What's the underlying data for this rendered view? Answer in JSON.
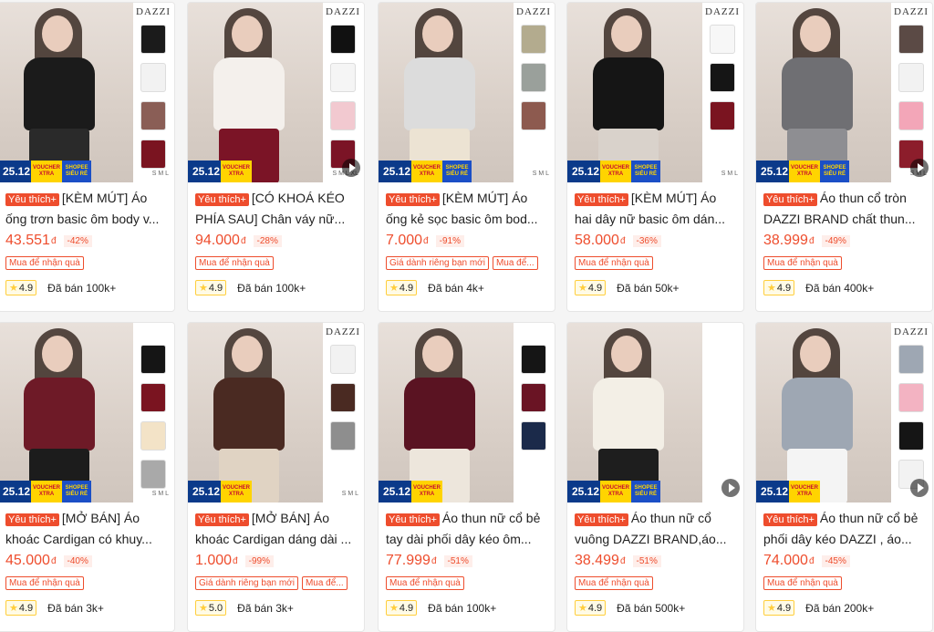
{
  "products": [
    {
      "promo_date": "25.12",
      "promo_v1": "VOUCHER XTRA",
      "promo_v2": "SHOPEE SIÊU RẺ",
      "badge": "Yêu thích+",
      "title": "[KÈM MÚT] Áo ống trơn basic ôm body v...",
      "price": "43.551",
      "currency": "đ",
      "discount": "-42%",
      "tags": [
        "Mua để nhận quà"
      ],
      "rating": "4.9",
      "sold": "Đã bán 100k+",
      "brand": "DAZZI",
      "sizes": "S M L",
      "top_color": "#1b1b1b",
      "bottom_color": "#2a2a2a",
      "swatches": [
        "#1b1b1b",
        "#f2f2f2",
        "#8a5e56",
        "#7a1420"
      ],
      "video": false
    },
    {
      "promo_date": "25.12",
      "promo_v1": "VOUCHER XTRA",
      "promo_v2": "",
      "badge": "Yêu thích+",
      "title": "[CÓ KHOÁ KÉO PHÍA SAU] Chân váy nữ...",
      "price": "94.000",
      "currency": "đ",
      "discount": "-28%",
      "tags": [
        "Mua để nhận quà"
      ],
      "rating": "4.9",
      "sold": "Đã bán 100k+",
      "brand": "DAZZI",
      "sizes": "S M L XL",
      "top_color": "#f4f0ec",
      "bottom_color": "#7b1426",
      "swatches": [
        "#111111",
        "#f5f5f5",
        "#f2c9d0",
        "#7b1426"
      ],
      "video": true
    },
    {
      "promo_date": "25.12",
      "promo_v1": "VOUCHER XTRA",
      "promo_v2": "SHOPEE SIÊU RẺ",
      "badge": "Yêu thích+",
      "title": "[KÈM MÚT] Áo ống kẻ sọc basic ôm bod...",
      "price": "7.000",
      "currency": "đ",
      "discount": "-91%",
      "tags": [
        "Giá dành riêng bạn mới",
        "Mua để..."
      ],
      "rating": "4.9",
      "sold": "Đã bán 4k+",
      "brand": "DAZZI",
      "sizes": "S M L",
      "top_color": "#dcdcdc",
      "bottom_color": "#ece3d3",
      "swatches": [
        "#b3ab8e",
        "#9aa09b",
        "#8d5a4f"
      ],
      "video": false
    },
    {
      "promo_date": "25.12",
      "promo_v1": "VOUCHER XTRA",
      "promo_v2": "SHOPEE SIÊU RẺ",
      "badge": "Yêu thích+",
      "title": "[KÈM MÚT] Áo hai dây nữ basic ôm dán...",
      "price": "58.000",
      "currency": "đ",
      "discount": "-36%",
      "tags": [
        "Mua để nhận quà"
      ],
      "rating": "4.9",
      "sold": "Đã bán 50k+",
      "brand": "DAZZI",
      "sizes": "S M L",
      "top_color": "#151515",
      "bottom_color": "#d9d2cb",
      "swatches": [
        "#f7f7f7",
        "#151515",
        "#7a1420"
      ],
      "video": false
    },
    {
      "promo_date": "25.12",
      "promo_v1": "VOUCHER XTRA",
      "promo_v2": "SHOPEE SIÊU RẺ",
      "badge": "Yêu thích+",
      "title": "Áo thun cổ tròn DAZZI BRAND chất thun...",
      "price": "38.999",
      "currency": "đ",
      "discount": "-49%",
      "tags": [
        "Mua để nhận quà"
      ],
      "rating": "4.9",
      "sold": "Đã bán 400k+",
      "brand": "DAZZI",
      "sizes": "S M L",
      "top_color": "#6f6f73",
      "bottom_color": "#8e8e92",
      "swatches": [
        "#5b4a45",
        "#f2f2f2",
        "#f3a6b8",
        "#8c1d2b"
      ],
      "video": true
    },
    {
      "promo_date": "25.12",
      "promo_v1": "VOUCHER XTRA",
      "promo_v2": "SHOPEE SIÊU RẺ",
      "badge": "Yêu thích+",
      "title": "[MỞ BÁN] Áo khoác Cardigan có khuy...",
      "price": "45.000",
      "currency": "đ",
      "discount": "-40%",
      "tags": [
        "Mua để nhận quà"
      ],
      "rating": "4.9",
      "sold": "Đã bán 3k+",
      "brand": "",
      "sizes": "S M L",
      "top_color": "#6e1a27",
      "bottom_color": "#1c1c1c",
      "swatches": [
        "#151515",
        "#7a1420",
        "#f3e3c7",
        "#a9a9a9"
      ],
      "video": false
    },
    {
      "promo_date": "25.12",
      "promo_v1": "VOUCHER XTRA",
      "promo_v2": "",
      "badge": "Yêu thích+",
      "title": "[MỞ BÁN] Áo khoác Cardigan dáng dài ...",
      "price": "1.000",
      "currency": "đ",
      "discount": "-99%",
      "tags": [
        "Giá dành riêng bạn mới",
        "Mua để..."
      ],
      "rating": "5.0",
      "sold": "Đã bán 3k+",
      "brand": "DAZZI",
      "sizes": "S M L",
      "top_color": "#4a2a22",
      "bottom_color": "#e0d3c3",
      "swatches": [
        "#f2f2f2",
        "#4a2a22",
        "#8e8e8e"
      ],
      "video": false
    },
    {
      "promo_date": "25.12",
      "promo_v1": "VOUCHER XTRA",
      "promo_v2": "",
      "badge": "Yêu thích+",
      "title": "Áo thun nữ cổ bẻ tay dài phối dây kéo ôm...",
      "price": "77.999",
      "currency": "đ",
      "discount": "-51%",
      "tags": [
        "Mua để nhận quà"
      ],
      "rating": "4.9",
      "sold": "Đã bán 100k+",
      "brand": "",
      "sizes": "",
      "top_color": "#5a1322",
      "bottom_color": "#ede6dc",
      "swatches": [
        "#151515",
        "#6a1424",
        "#1b2a4a"
      ],
      "video": false
    },
    {
      "promo_date": "25.12",
      "promo_v1": "VOUCHER XTRA",
      "promo_v2": "SHOPEE SIÊU RẺ",
      "badge": "Yêu thích+",
      "title": "Áo thun nữ cổ vuông DAZZI BRAND,áo...",
      "price": "38.499",
      "currency": "đ",
      "discount": "-51%",
      "tags": [
        "Mua để nhận quà"
      ],
      "rating": "4.9",
      "sold": "Đã bán 500k+",
      "brand": "",
      "sizes": "",
      "top_color": "#f3efe6",
      "bottom_color": "#1e1e1e",
      "swatches": [],
      "video": true
    },
    {
      "promo_date": "25.12",
      "promo_v1": "VOUCHER XTRA",
      "promo_v2": "",
      "badge": "Yêu thích+",
      "title": "Áo thun nữ cổ bẻ phối dây kéo DAZZI , áo...",
      "price": "74.000",
      "currency": "đ",
      "discount": "-45%",
      "tags": [
        "Mua để nhận quà"
      ],
      "rating": "4.9",
      "sold": "Đã bán 200k+",
      "brand": "DAZZI",
      "sizes": "",
      "top_color": "#9ea7b3",
      "bottom_color": "#f4f4f4",
      "swatches": [
        "#9ea7b3",
        "#f3b3c2",
        "#151515",
        "#f2f2f2"
      ],
      "video": true
    }
  ]
}
